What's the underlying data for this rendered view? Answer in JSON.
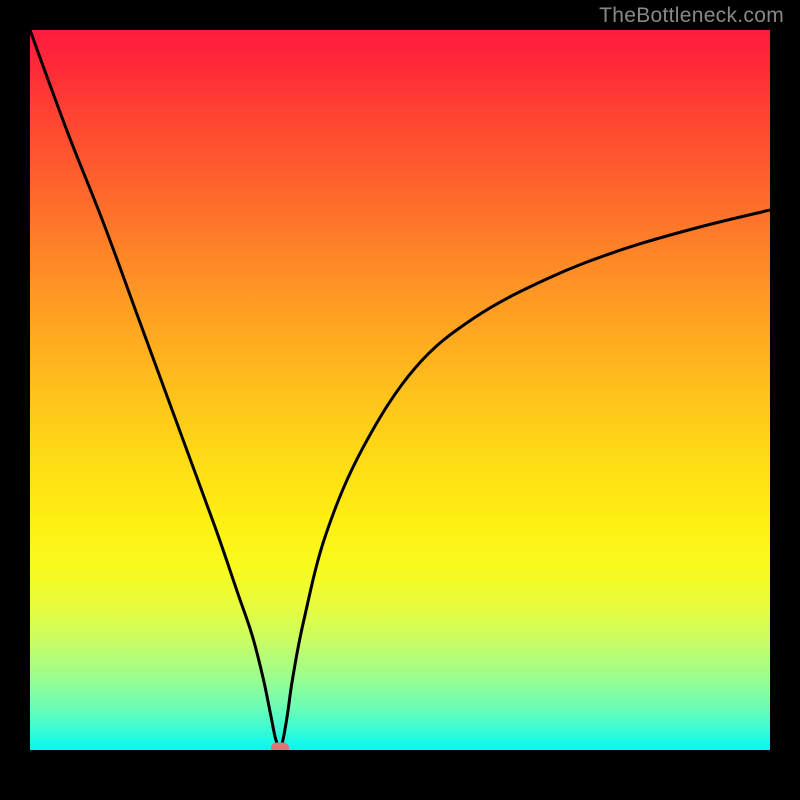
{
  "watermark": "TheBottleneck.com",
  "chart_data": {
    "type": "line",
    "title": "",
    "xlabel": "",
    "ylabel": "",
    "x": [
      0,
      5,
      10,
      15,
      20,
      25,
      28,
      30,
      31.5,
      32.5,
      33.2,
      33.8,
      34.2,
      34.8,
      35.5,
      37,
      40,
      45,
      52,
      60,
      70,
      80,
      90,
      100
    ],
    "y": [
      100,
      86,
      73,
      59,
      45,
      31,
      22,
      16,
      10,
      5,
      1.5,
      0.3,
      1.5,
      5,
      10,
      18,
      30,
      42,
      53,
      60,
      65.5,
      69.5,
      72.5,
      75
    ],
    "xlim": [
      0,
      100
    ],
    "ylim": [
      0,
      100
    ],
    "curve_minimum": {
      "x": 33.8,
      "y": 0.3
    },
    "marker_position": {
      "x": 33.8,
      "y": 0.3
    },
    "gradient_colors": {
      "top": "#FF1A3F",
      "middle": "#FFDC15",
      "bottom": "#05F8EE"
    }
  }
}
